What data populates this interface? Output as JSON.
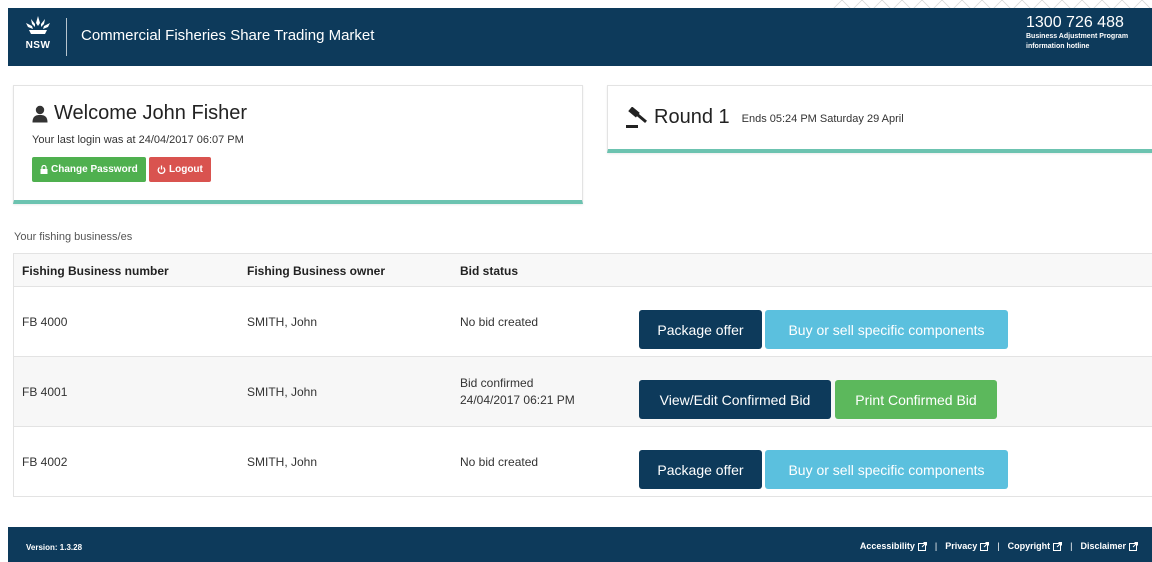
{
  "header": {
    "logo_text": "NSW",
    "title": "Commercial Fisheries Share Trading Market",
    "hotline_number": "1300 726 488",
    "hotline_line1": "Business Adjustment Program",
    "hotline_line2": "information hotline"
  },
  "welcome": {
    "title": "Welcome John Fisher",
    "last_login": "Your last login was at 24/04/2017 06:07 PM",
    "change_password": "Change Password",
    "logout": "Logout"
  },
  "round": {
    "label": "Round 1",
    "ends": "Ends 05:24 PM Saturday 29 April"
  },
  "businesses": {
    "section_label": "Your fishing business/es",
    "columns": [
      "Fishing Business number",
      "Fishing Business owner",
      "Bid status"
    ],
    "rows": [
      {
        "number": "FB 4000",
        "owner": "SMITH, John",
        "status_line1": "No bid created",
        "status_line2": "",
        "primary_action": "Package offer",
        "secondary_action": "Buy or sell specific components"
      },
      {
        "number": "FB 4001",
        "owner": "SMITH, John",
        "status_line1": "Bid confirmed",
        "status_line2": "24/04/2017 06:21 PM",
        "primary_action": "View/Edit Confirmed Bid",
        "secondary_action": "Print Confirmed Bid"
      },
      {
        "number": "FB 4002",
        "owner": "SMITH, John",
        "status_line1": "No bid created",
        "status_line2": "",
        "primary_action": "Package offer",
        "secondary_action": "Buy or sell specific components"
      }
    ]
  },
  "footer": {
    "version": "Version: 1.3.28",
    "links": [
      "Accessibility",
      "Privacy",
      "Copyright",
      "Disclaimer"
    ],
    "separator": "|"
  },
  "colors": {
    "navy": "#0d3a5b",
    "teal_accent": "#6cc3b0",
    "green": "#5cb85c",
    "red": "#d9534f",
    "light_blue": "#5bc0de"
  },
  "icons": [
    "nsw-waratah-logo",
    "user-icon",
    "lock-icon",
    "power-icon",
    "gavel-icon",
    "external-link-icon"
  ]
}
